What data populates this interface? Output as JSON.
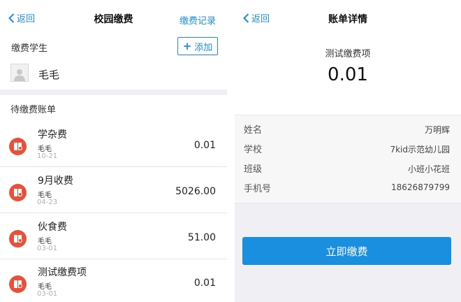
{
  "left": {
    "nav": {
      "back_label": "返回",
      "title": "校园缴费",
      "right_label": "缴费记录"
    },
    "students_section_label": "缴费学生",
    "add_button_label": "添加",
    "student": {
      "name": "毛毛"
    },
    "pending_label": "待缴费账单",
    "bills": [
      {
        "title": "学杂费",
        "student": "毛毛",
        "date": "10-21",
        "amount": "0.01"
      },
      {
        "title": "9月收费",
        "student": "毛毛",
        "date": "04-23",
        "amount": "5026.00"
      },
      {
        "title": "伙食费",
        "student": "毛毛",
        "date": "03-01",
        "amount": "51.00"
      },
      {
        "title": "测试缴费项",
        "student": "毛毛",
        "date": "03-01",
        "amount": "0.01"
      }
    ]
  },
  "right": {
    "nav": {
      "back_label": "返回",
      "title": "账单详情"
    },
    "item_name": "测试缴费项",
    "amount": "0.01",
    "info": [
      {
        "key": "姓名",
        "value": "万明辉"
      },
      {
        "key": "学校",
        "value": "7kid示范幼儿园"
      },
      {
        "key": "班级",
        "value": "小班小花班"
      },
      {
        "key": "手机号",
        "value": "18626879799"
      }
    ],
    "pay_button_label": "立即缴费"
  },
  "colors": {
    "accent": "#1a8fe0",
    "bill_icon": "#e8503a",
    "band": "#efeff4"
  }
}
